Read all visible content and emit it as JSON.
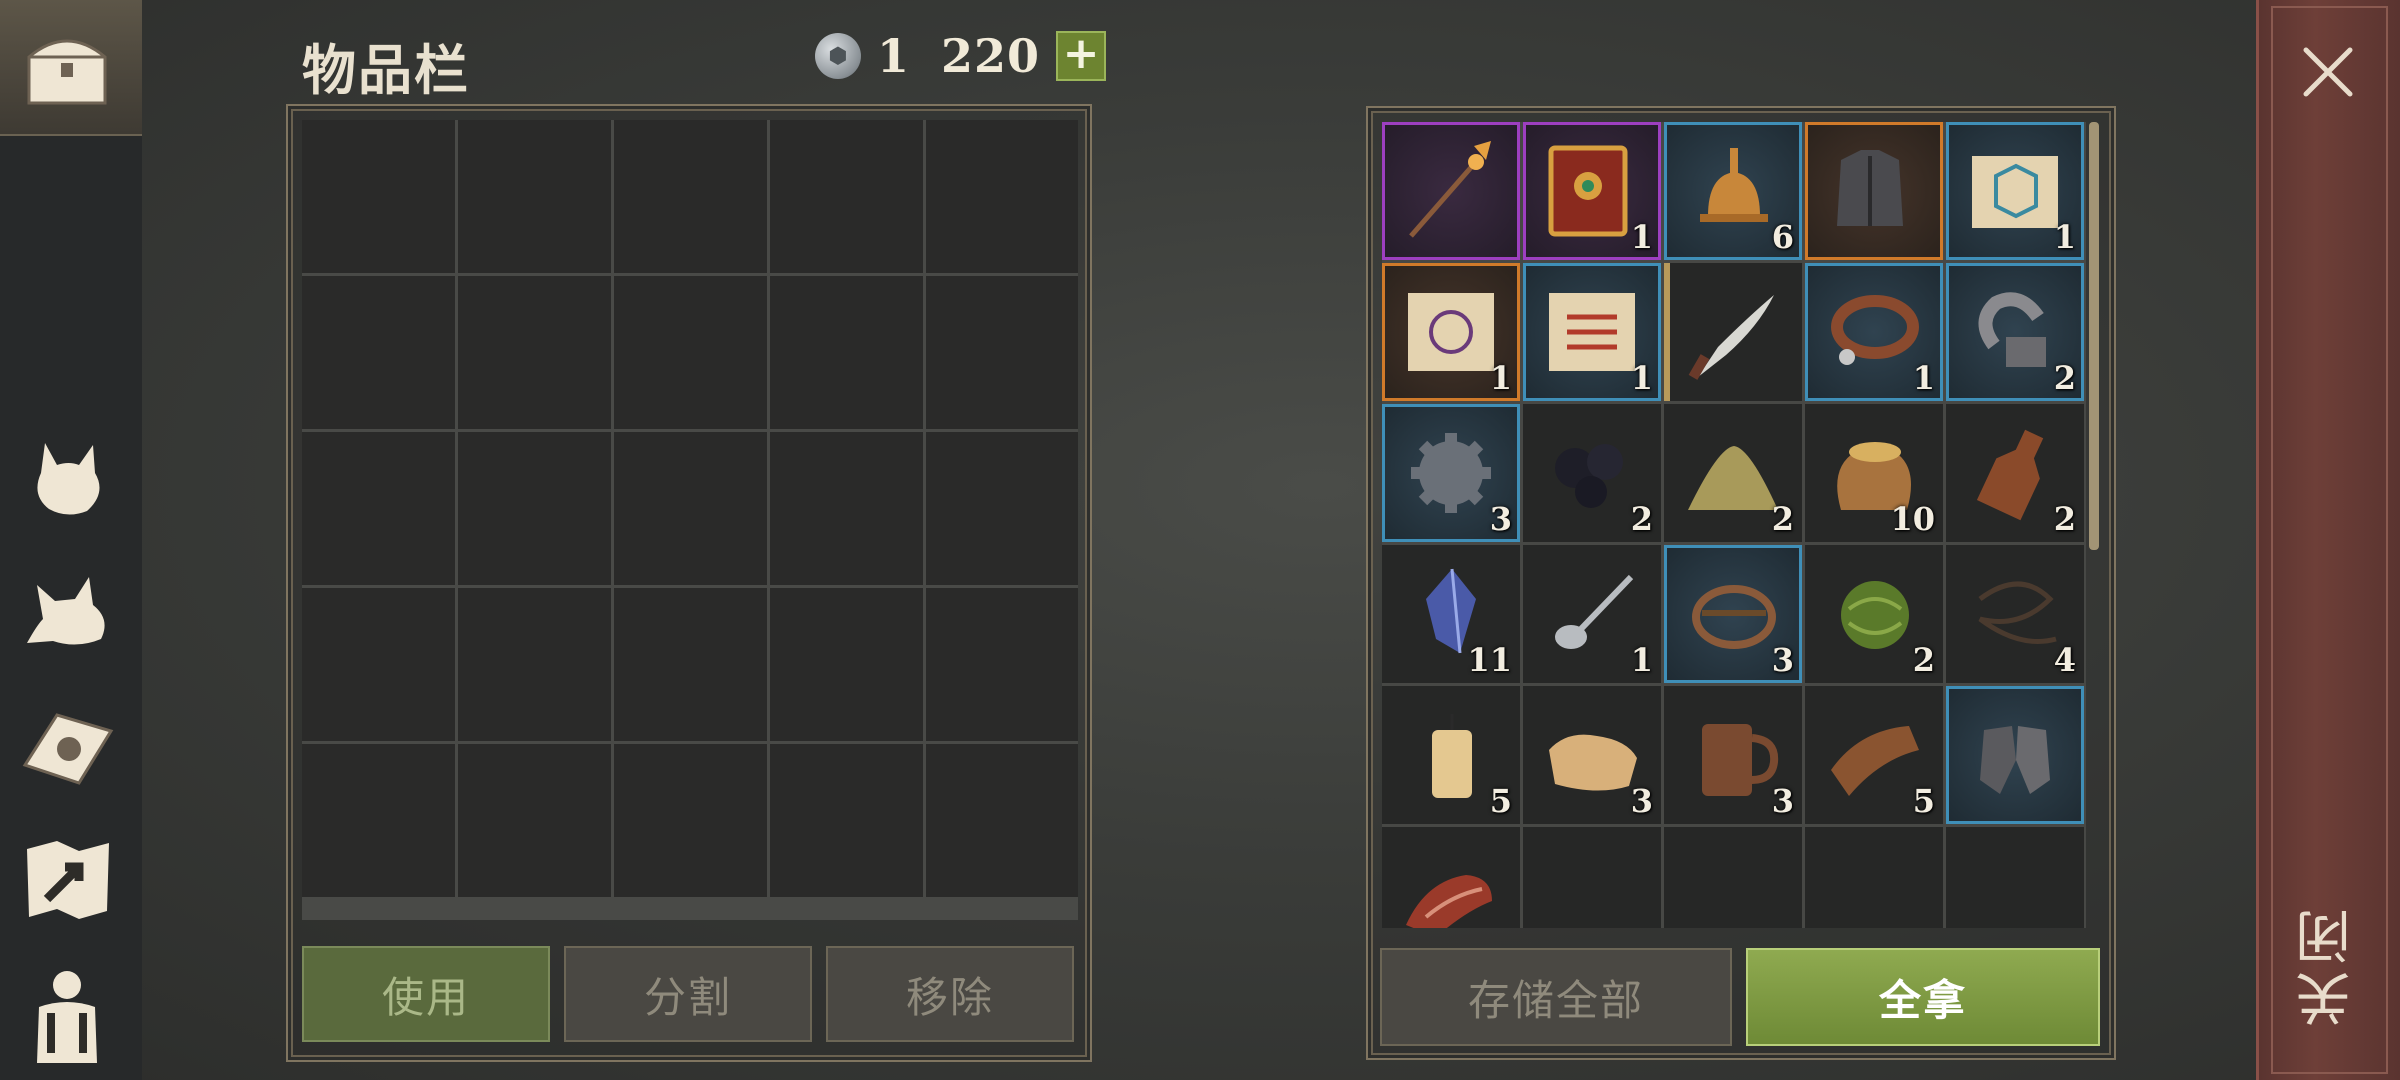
{
  "inventory": {
    "title": "物品栏",
    "currency_value": "1 220",
    "currency_icon": "silver-coin-icon",
    "add_currency_label": "+",
    "slots": 25
  },
  "actions": {
    "use": "使用",
    "split": "分割",
    "remove": "移除"
  },
  "storage": {
    "store_all": "存储全部",
    "take_all": "全拿",
    "items": [
      {
        "icon": "spear-icon",
        "rarity": "purple",
        "qty": ""
      },
      {
        "icon": "spellbook-icon",
        "rarity": "purple",
        "qty": "1"
      },
      {
        "icon": "bell-icon",
        "rarity": "blue",
        "qty": "6"
      },
      {
        "icon": "armor-icon",
        "rarity": "orange",
        "qty": ""
      },
      {
        "icon": "scroll-blue-icon",
        "rarity": "blue",
        "qty": "1"
      },
      {
        "icon": "scroll-purple-icon",
        "rarity": "orange",
        "qty": "1"
      },
      {
        "icon": "scroll-red-icon",
        "rarity": "blue",
        "qty": "1"
      },
      {
        "icon": "machete-icon",
        "rarity": "gold",
        "qty": ""
      },
      {
        "icon": "collar-icon",
        "rarity": "blue",
        "qty": "1"
      },
      {
        "icon": "shackle-icon",
        "rarity": "blue",
        "qty": "2"
      },
      {
        "icon": "gear-icon",
        "rarity": "blue",
        "qty": "3"
      },
      {
        "icon": "coal-icon",
        "rarity": "none",
        "qty": "2"
      },
      {
        "icon": "powder-pile-icon",
        "rarity": "none",
        "qty": "2"
      },
      {
        "icon": "grain-sack-icon",
        "rarity": "none",
        "qty": "10"
      },
      {
        "icon": "flask-icon",
        "rarity": "none",
        "qty": "2"
      },
      {
        "icon": "crystal-icon",
        "rarity": "none",
        "qty": "11"
      },
      {
        "icon": "spoon-icon",
        "rarity": "none",
        "qty": "1"
      },
      {
        "icon": "bear-trap-icon",
        "rarity": "blue",
        "qty": "3"
      },
      {
        "icon": "herb-ball-icon",
        "rarity": "none",
        "qty": "2"
      },
      {
        "icon": "rope-icon",
        "rarity": "none",
        "qty": "4"
      },
      {
        "icon": "candle-icon",
        "rarity": "none",
        "qty": "5"
      },
      {
        "icon": "cloth-icon",
        "rarity": "none",
        "qty": "3"
      },
      {
        "icon": "mug-icon",
        "rarity": "none",
        "qty": "3"
      },
      {
        "icon": "leather-icon",
        "rarity": "none",
        "qty": "5"
      },
      {
        "icon": "gauntlets-icon",
        "rarity": "blue",
        "qty": ""
      },
      {
        "icon": "meat-icon",
        "rarity": "none",
        "qty": ""
      },
      {
        "icon": "",
        "rarity": "none",
        "qty": ""
      },
      {
        "icon": "",
        "rarity": "none",
        "qty": ""
      },
      {
        "icon": "",
        "rarity": "none",
        "qty": ""
      },
      {
        "icon": "",
        "rarity": "none",
        "qty": ""
      }
    ]
  },
  "sidebar": {
    "items": [
      {
        "name": "chest-tab",
        "icon": "chest-icon"
      },
      {
        "name": "cat-tab",
        "icon": "cat-icon"
      },
      {
        "name": "wolf-tab",
        "icon": "wolf-icon"
      },
      {
        "name": "sun-book-tab",
        "icon": "sun-book-icon"
      },
      {
        "name": "map-tab",
        "icon": "map-arrow-icon"
      },
      {
        "name": "character-tab",
        "icon": "character-icon"
      }
    ]
  },
  "close": {
    "label": "关闭",
    "icon": "close-icon"
  },
  "colors": {
    "blue_rarity": "#3f8fb8",
    "purple_rarity": "#9d3fc0",
    "orange_rarity": "#d07a2a",
    "accent_green": "#7f9a40"
  }
}
